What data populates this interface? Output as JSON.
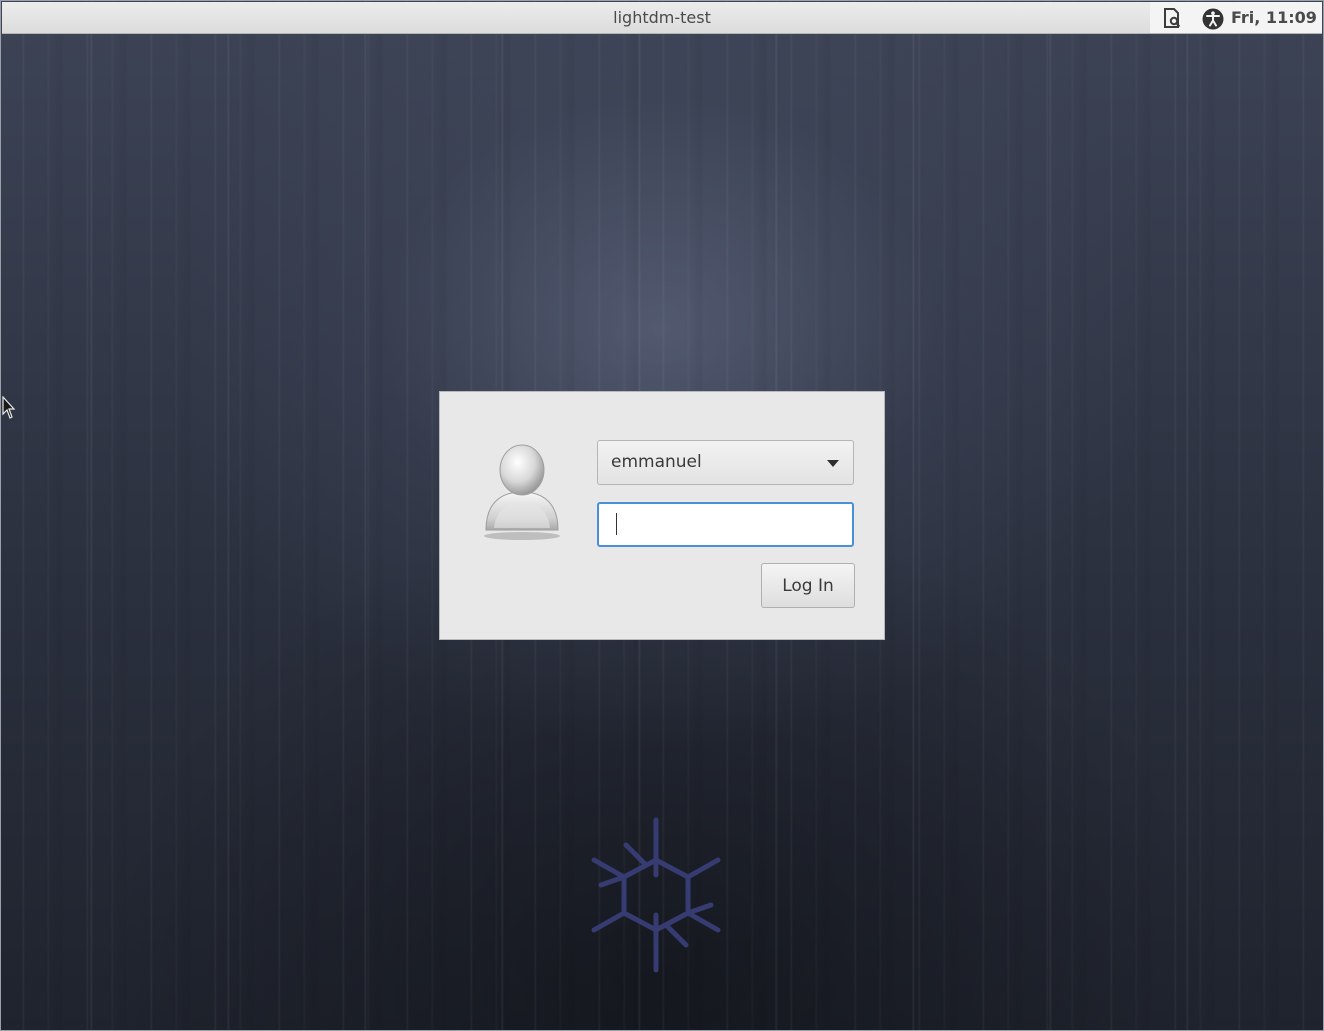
{
  "top_panel": {
    "title": "lightdm-test",
    "clock": "Fri, 11:09",
    "indicators": [
      {
        "icon": "document-icon",
        "label": "Session menu"
      },
      {
        "icon": "accessibility-icon",
        "label": "Accessibility"
      }
    ]
  },
  "login": {
    "avatar_icon": "user-avatar-icon",
    "selected_user": "emmanuel",
    "password_value": "",
    "login_button_label": "Log In",
    "focus_color": "#4a90d9"
  },
  "background": {
    "logo_icon": "snowflake-logo-icon",
    "base_color": "#2a2f3d"
  }
}
